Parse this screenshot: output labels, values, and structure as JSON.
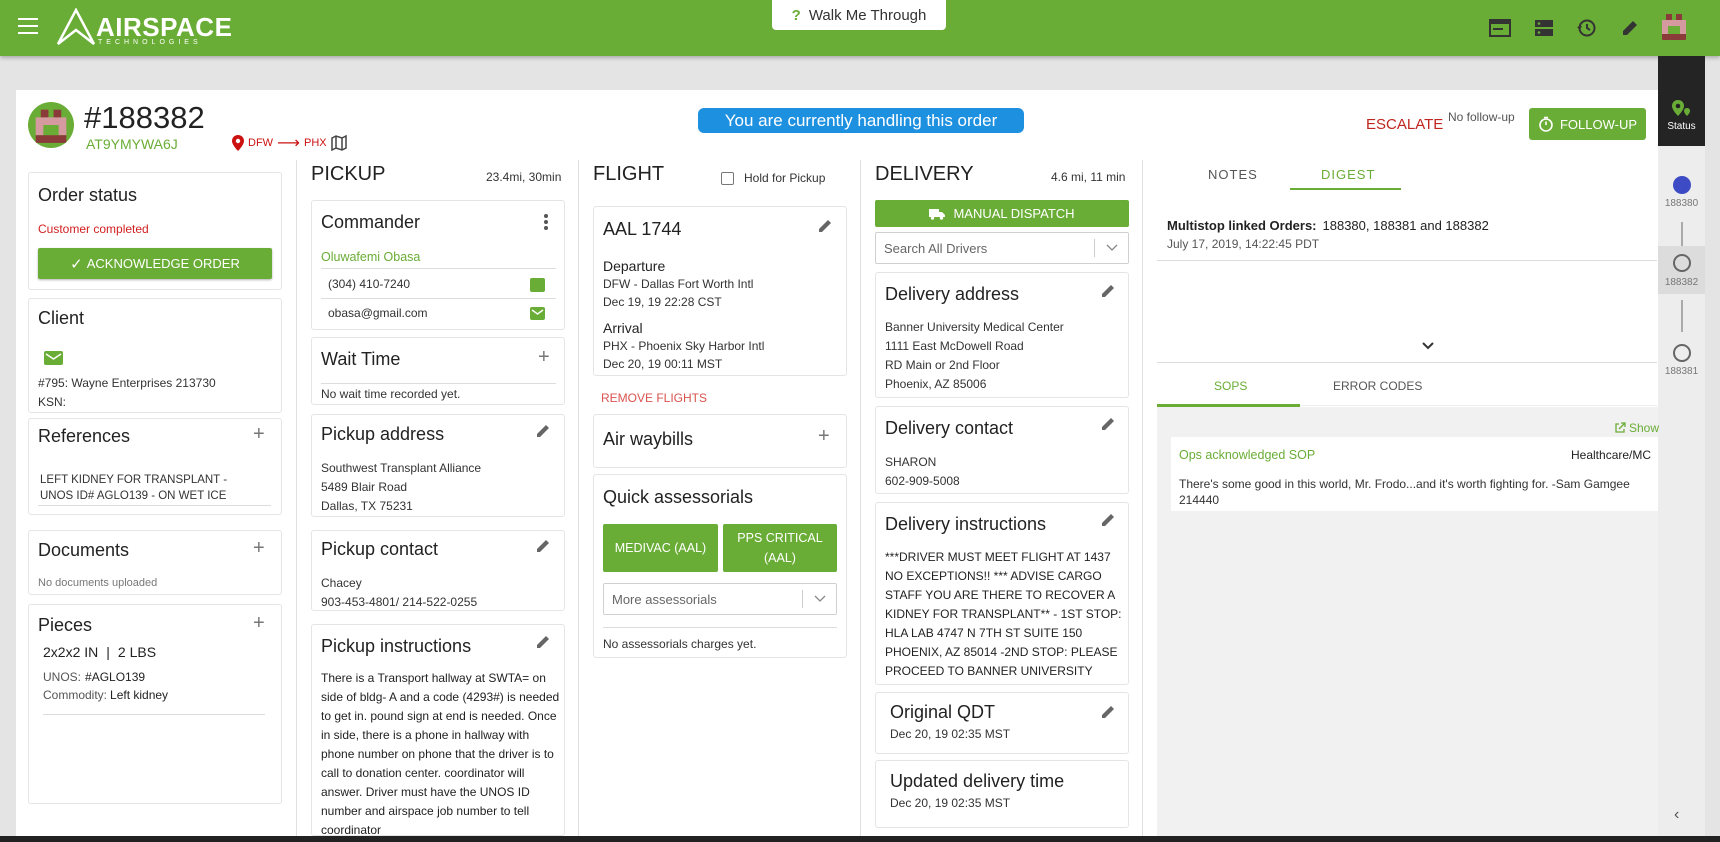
{
  "brand": {
    "name": "AIRSPACE",
    "sub": "TECHNOLOGIES"
  },
  "walk_through": "Walk Me Through",
  "order": {
    "number": "#188382",
    "code": "AT9YMYWA6J",
    "from": "DFW",
    "to": "PHX"
  },
  "handling_banner": "You are currently handling this order",
  "escalate": "ESCALATE",
  "no_follow_up": "No follow-up",
  "follow_up": "FOLLOW-UP",
  "left": {
    "order_status": {
      "title": "Order status",
      "status": "Customer completed",
      "ack_button": "ACKNOWLEDGE ORDER"
    },
    "client": {
      "title": "Client",
      "line1": "#795: Wayne Enterprises 213730",
      "line2": "KSN:"
    },
    "references": {
      "title": "References",
      "text": "LEFT KIDNEY FOR TRANSPLANT - UNOS ID# AGLO139 - ON WET ICE"
    },
    "documents": {
      "title": "Documents",
      "empty": "No documents uploaded"
    },
    "pieces": {
      "title": "Pieces",
      "dims": "2x2x2 IN",
      "weight": "2 LBS",
      "unos_label": "UNOS:",
      "unos_value": "#AGLO139",
      "commodity_label": "Commodity:",
      "commodity_value": "Left kidney"
    }
  },
  "pickup": {
    "title": "PICKUP",
    "distance": "23.4mi, 30min",
    "commander": {
      "title": "Commander",
      "name": "Oluwafemi Obasa",
      "phone": "(304) 410-7240",
      "email": "obasa@gmail.com"
    },
    "wait_time": {
      "title": "Wait Time",
      "text": "No wait time recorded yet."
    },
    "address": {
      "title": "Pickup address",
      "l1": "Southwest Transplant Alliance",
      "l2": "5489 Blair Road",
      "l3": "Dallas, TX 75231"
    },
    "contact": {
      "title": "Pickup contact",
      "name": "Chacey",
      "phone": "903-453-4801/ 214-522-0255"
    },
    "instructions": {
      "title": "Pickup instructions",
      "text": "There is a Transport hallway at SWTA= on side of bldg- A and a code (4293#) is needed to get in. pound sign at end is needed. Once in side, there is a phone in hallway with phone number on phone that the driver is to call to donation center. coordinator will answer. Driver must have the UNOS ID number and airspace job number to tell coordinator"
    }
  },
  "flight": {
    "title": "FLIGHT",
    "hold_label": "Hold for Pickup",
    "number": "AAL 1744",
    "departure_label": "Departure",
    "departure_airport": "DFW - Dallas Fort Worth Intl",
    "departure_time": "Dec 19, 19 22:28 CST",
    "arrival_label": "Arrival",
    "arrival_airport": "PHX - Phoenix Sky Harbor Intl",
    "arrival_time": "Dec 20, 19 00:11 MST",
    "remove": "REMOVE FLIGHTS",
    "waybills": "Air waybills",
    "quick": "Quick assessorials",
    "medivac": "MEDIVAC (AAL)",
    "pps": "PPS CRITICAL (AAL)",
    "more": "More assessorials",
    "no_charges": "No assessorials charges yet."
  },
  "delivery": {
    "title": "DELIVERY",
    "distance": "4.6 mi, 11 min",
    "manual_dispatch": "MANUAL DISPATCH",
    "search_drivers": "Search All Drivers",
    "address": {
      "title": "Delivery address",
      "l1": "Banner University Medical Center",
      "l2": "1111 East McDowell Road",
      "l3": "RD Main or 2nd Floor",
      "l4": "Phoenix, AZ 85006"
    },
    "contact": {
      "title": "Delivery contact",
      "name": "SHARON",
      "phone": "602-909-5008"
    },
    "instructions": {
      "title": "Delivery instructions",
      "text": "***DRIVER MUST MEET FLIGHT AT 1437 NO EXCEPTIONS!! *** ADVISE CARGO STAFF YOU ARE THERE TO RECOVER A KIDNEY FOR TRANSPLANT** - 1ST STOP: HLA LAB 4747 N 7TH ST SUITE 150 PHOENIX, AZ 85014 -2ND STOP: PLEASE PROCEED TO BANNER UNIVERSITY"
    },
    "original_qdt": {
      "title": "Original QDT",
      "time": "Dec 20, 19 02:35 MST"
    },
    "updated": {
      "title": "Updated delivery time",
      "time": "Dec 20, 19 02:35 MST"
    }
  },
  "right": {
    "tab_notes": "NOTES",
    "tab_digest": "DIGEST",
    "multistop_label": "Multistop linked Orders:",
    "multistop_values": "188380, 188381 and 188382",
    "multistop_date": "July 17, 2019, 14:22:45 PDT",
    "tab_sops": "SOPS",
    "tab_errors": "ERROR CODES",
    "show": "Show",
    "sop_ack": "Ops acknowledged SOP",
    "sop_cat": "Healthcare/MC",
    "sop_text": "There's some good in this world, Mr. Frodo...and it's worth fighting for. -Sam Gamgee 214440"
  },
  "rail": {
    "status": "Status",
    "o1": "188380",
    "o2": "188382",
    "o3": "188381"
  },
  "colors": {
    "green": "#6aad36",
    "blue": "#1e90e0",
    "red": "#c0251f"
  }
}
